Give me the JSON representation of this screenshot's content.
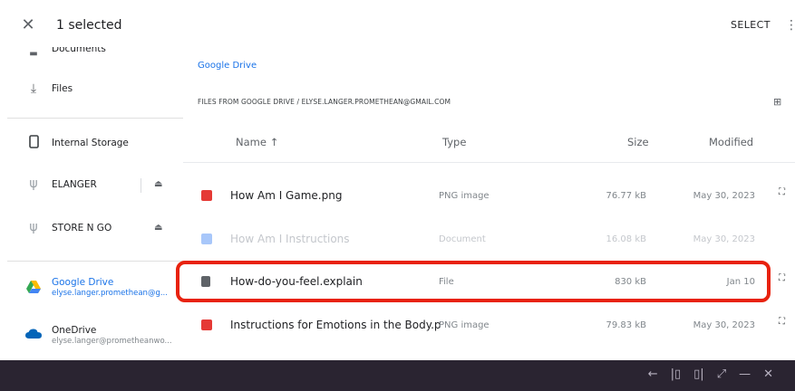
{
  "topbar": {
    "close_icon": "close-icon",
    "selection_count": "1 selected",
    "select_label": "SELECT",
    "more_icon": "more-vert-icon"
  },
  "sidebar": {
    "items": [
      {
        "label": "Documents",
        "icon": "document-icon"
      },
      {
        "label": "Files",
        "icon": "download-icon"
      },
      {
        "label": "Internal Storage",
        "icon": "phone-icon"
      },
      {
        "label": "ELANGER",
        "icon": "usb-icon",
        "eject": true
      },
      {
        "label": "STORE N GO",
        "icon": "usb-icon",
        "eject": true
      },
      {
        "label": "Google Drive",
        "sub": "elyse.langer.promethean@g...",
        "icon": "google-drive-icon",
        "active": true
      },
      {
        "label": "OneDrive",
        "sub": "elyse.langer@prometheanwo...",
        "icon": "onedrive-icon"
      }
    ]
  },
  "main": {
    "breadcrumb": "Google Drive",
    "path": "FILES FROM GOOGLE DRIVE / ELYSE.LANGER.PROMETHEAN@GMAIL.COM",
    "columns": {
      "name": "Name ↑",
      "type": "Type",
      "size": "Size",
      "modified": "Modified"
    },
    "rows": [
      {
        "name": "How Am I Game.png",
        "type": "PNG image",
        "size": "76.77 kB",
        "modified": "May 30, 2023",
        "icon": "image-icon",
        "icon_color": "#e53935",
        "dim": false,
        "expand": true
      },
      {
        "name": "How Am I Instructions",
        "type": "Document",
        "size": "16.08 kB",
        "modified": "May 30, 2023",
        "icon": "doc-icon",
        "icon_color": "#4285f4",
        "dim": true,
        "expand": false
      },
      {
        "name": "How-do-you-feel.explain",
        "type": "File",
        "size": "830 kB",
        "modified": "Jan 10",
        "icon": "file-icon",
        "icon_color": "#5f6368",
        "dim": false,
        "expand": true
      },
      {
        "name": "Instructions for Emotions in the Body.png",
        "type": "PNG image",
        "size": "79.83 kB",
        "modified": "May 30, 2023",
        "icon": "image-icon",
        "icon_color": "#e53935",
        "dim": false,
        "expand": true
      }
    ]
  },
  "colors": {
    "accent": "#1a73e8",
    "highlight": "#e8220e",
    "bottom_bar": "#2a2431"
  }
}
